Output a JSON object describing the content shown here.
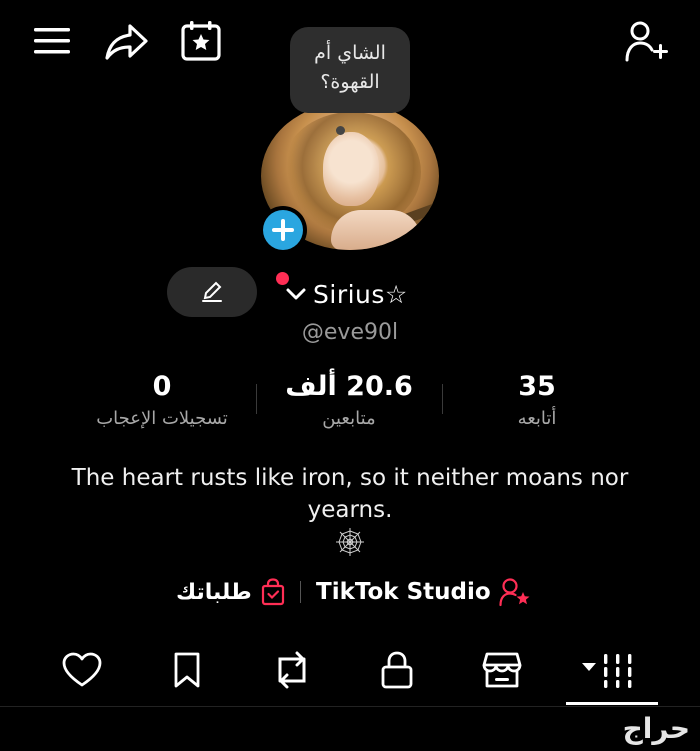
{
  "topbar": {
    "icons": [
      "menu-icon",
      "share-icon",
      "calendar-star-icon",
      "add-user-icon"
    ]
  },
  "profile": {
    "note_bubble": "الشاي أم القهوة؟",
    "display_name": "Sirius☆",
    "username": "@eve90l",
    "live_dot_color": "#ff2e55",
    "avatar_add_color": "#2aa6e0"
  },
  "stats": [
    {
      "value": "35",
      "label": "أتابعه"
    },
    {
      "value": "20.6 ألف",
      "label": "متابعين"
    },
    {
      "value": "0",
      "label": "تسجيلات الإعجاب"
    }
  ],
  "bio": {
    "text": "The heart rusts like iron, so it neither moans nor yearns.",
    "icon": "spider-web-icon"
  },
  "links": {
    "studio": "TikTok Studio",
    "orders": "طلباتك",
    "accent": "#ff2e55"
  },
  "tabs": [
    "grid-tab",
    "shop-tab",
    "lock-tab",
    "repost-tab",
    "bookmark-tab",
    "heart-tab"
  ],
  "watermark": "حراج"
}
